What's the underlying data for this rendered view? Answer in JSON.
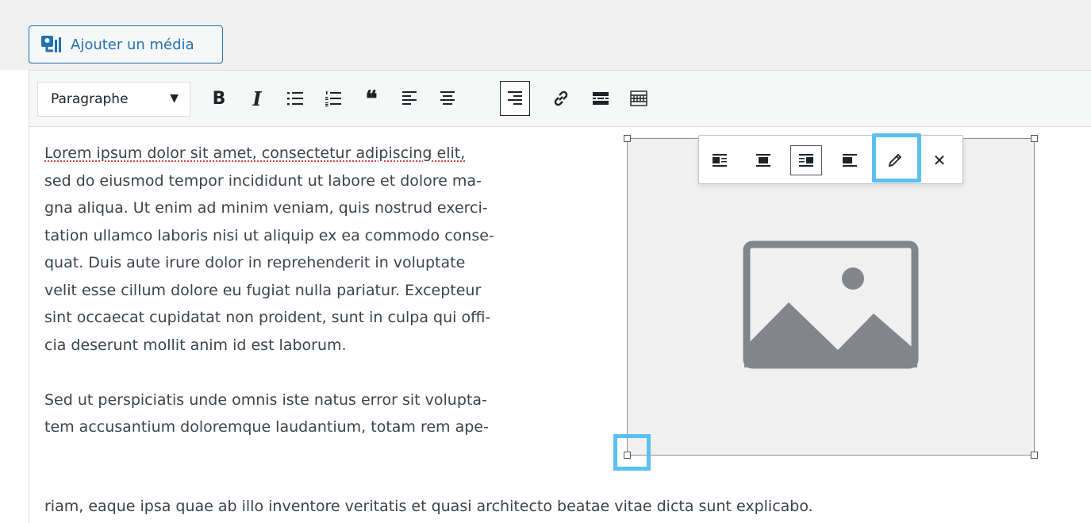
{
  "media_button": {
    "label": "Ajouter un média",
    "icon": "media-stack-icon"
  },
  "toolbar": {
    "format_select": {
      "value": "Paragraphe"
    },
    "buttons": [
      {
        "name": "bold",
        "glyph": "B"
      },
      {
        "name": "italic",
        "glyph": "I"
      },
      {
        "name": "bulleted-list",
        "icon": "bullet-list-icon"
      },
      {
        "name": "numbered-list",
        "icon": "numbered-list-icon"
      },
      {
        "name": "blockquote",
        "glyph": "❝"
      },
      {
        "name": "align-left",
        "icon": "align-left-icon"
      },
      {
        "name": "align-center",
        "icon": "align-center-icon"
      },
      {
        "name": "align-right",
        "icon": "align-right-icon",
        "active": true
      },
      {
        "name": "insert-link",
        "icon": "link-icon"
      },
      {
        "name": "read-more",
        "icon": "read-more-icon"
      },
      {
        "name": "toolbar-toggle",
        "icon": "keyboard-icon"
      }
    ]
  },
  "image_toolbar": {
    "buttons": [
      {
        "name": "align-left",
        "icon": "image-align-left-icon"
      },
      {
        "name": "align-center",
        "icon": "image-align-center-icon"
      },
      {
        "name": "align-right",
        "icon": "image-align-right-icon",
        "active": true
      },
      {
        "name": "align-none",
        "icon": "image-align-none-icon"
      },
      {
        "name": "edit",
        "icon": "pencil-icon"
      },
      {
        "name": "remove",
        "icon": "close-icon",
        "glyph": "✕"
      }
    ]
  },
  "content": {
    "p1_lines": [
      "Lorem ipsum dolor sit amet, consectetur adipiscing elit,",
      "sed do eiusmod tempor incididunt ut labore et dolore ma-",
      "gna aliqua. Ut enim ad minim veniam, quis nostrud exerci-",
      "tation ullamco laboris nisi ut aliquip ex ea commodo conse-",
      "quat. Duis aute irure dolor in reprehenderit in voluptate",
      "velit esse cillum dolore eu fugiat nulla pariatur. Excepteur",
      "sint occaecat cupidatat non proident, sunt in culpa qui offi-",
      "cia deserunt mollit anim id est laborum."
    ],
    "p2_lines": [
      "Sed ut perspiciatis unde omnis iste natus error sit volupta-",
      "tem accusantium doloremque laudantium, totam rem ape-",
      "riam, eaque ipsa quae ab illo inventore veritatis et quasi architecto beatae vitae dicta sunt explicabo."
    ]
  },
  "image": {
    "icon": "image-placeholder-icon"
  },
  "highlight_color": "#5bc0f0",
  "accent_color": "#2271b1"
}
